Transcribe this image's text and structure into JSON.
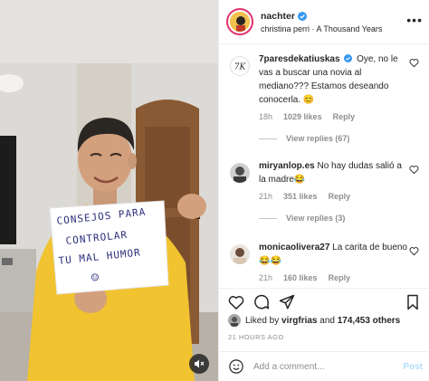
{
  "post": {
    "username": "nachter",
    "verified": true,
    "audio": "christina perri · A Thousand Years",
    "more_icon": "more-horizontal-icon"
  },
  "media": {
    "sign_lines": [
      "CONSEJOS PARA",
      "CONTROLAR",
      "TU MAL HUMOR"
    ],
    "sign_face": "☺",
    "mute_icon": "speaker-muted-icon"
  },
  "comments": [
    {
      "username": "7paresdekatiuskas",
      "verified": true,
      "text": "Oye, no le vas a buscar una novia al mediano??? Estamos deseando conocerla. 😊",
      "time": "18h",
      "likes": "1029 likes",
      "reply": "Reply",
      "view_replies": "View replies (67)"
    },
    {
      "username": "miryanlop.es",
      "verified": false,
      "text": "No hay dudas salió a la madre😂",
      "time": "21h",
      "likes": "351 likes",
      "reply": "Reply",
      "view_replies": "View replies (3)"
    },
    {
      "username": "monicaolivera27",
      "verified": false,
      "text": "La carita de bueno😂😂",
      "time": "21h",
      "likes": "160 likes",
      "reply": "Reply"
    }
  ],
  "likes_line": {
    "prefix": "Liked by",
    "user": "virgfrias",
    "conj": "and",
    "count": "174,453 others"
  },
  "time_ago": "21 HOURS AGO",
  "add_comment": {
    "placeholder": "Add a comment...",
    "post_label": "Post"
  },
  "colors": {
    "link_blue": "#0095f6",
    "post_disabled": "#b2dffc",
    "verified_blue": "#3897f0",
    "secondary_text": "#8e8e8e"
  }
}
